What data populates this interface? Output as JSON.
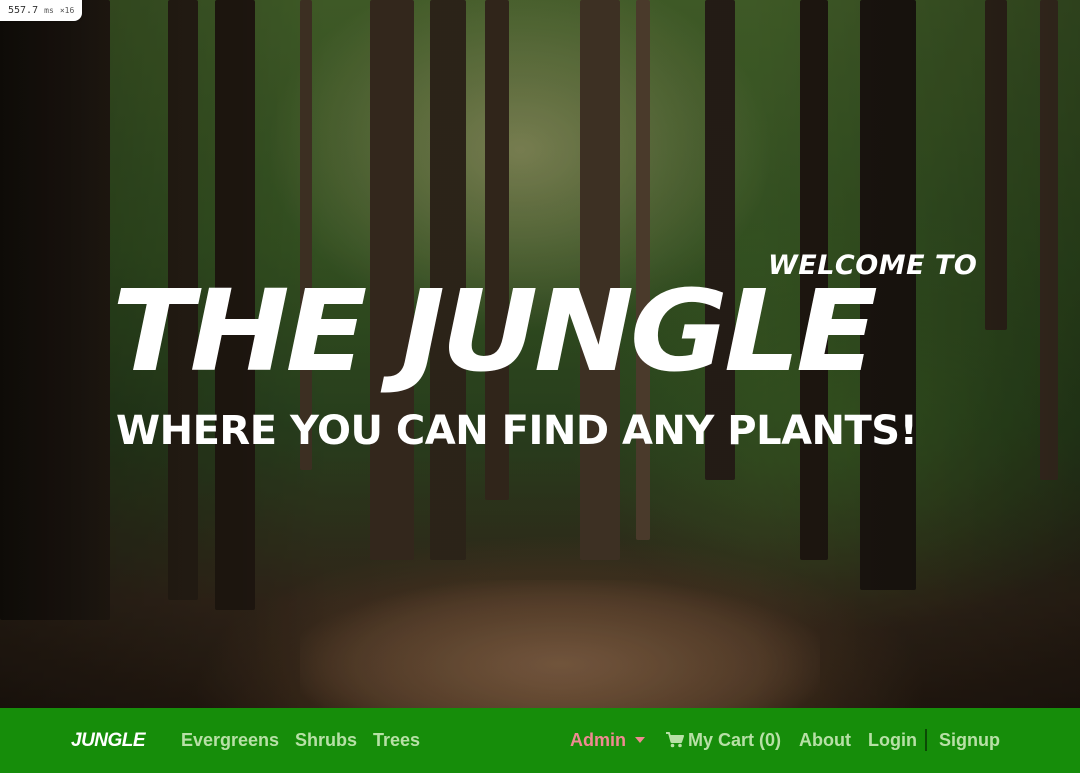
{
  "perf": {
    "ms": "557.7",
    "unit": "ms",
    "multiplier": "×16"
  },
  "hero": {
    "welcome": "WELCOME TO",
    "title": "THE JUNGLE",
    "tagline": "WHERE YOU CAN FIND ANY PLANTS!"
  },
  "nav": {
    "brand": "JUNGLE",
    "links": [
      "Evergreens",
      "Shrubs",
      "Trees"
    ],
    "admin": "Admin",
    "cart": "My Cart (0)",
    "about": "About",
    "login": "Login",
    "signup": "Signup"
  },
  "colors": {
    "nav_bg": "#168d0a",
    "nav_link": "#b7e0a6",
    "admin": "#f08a92",
    "brand": "#ffffff"
  }
}
